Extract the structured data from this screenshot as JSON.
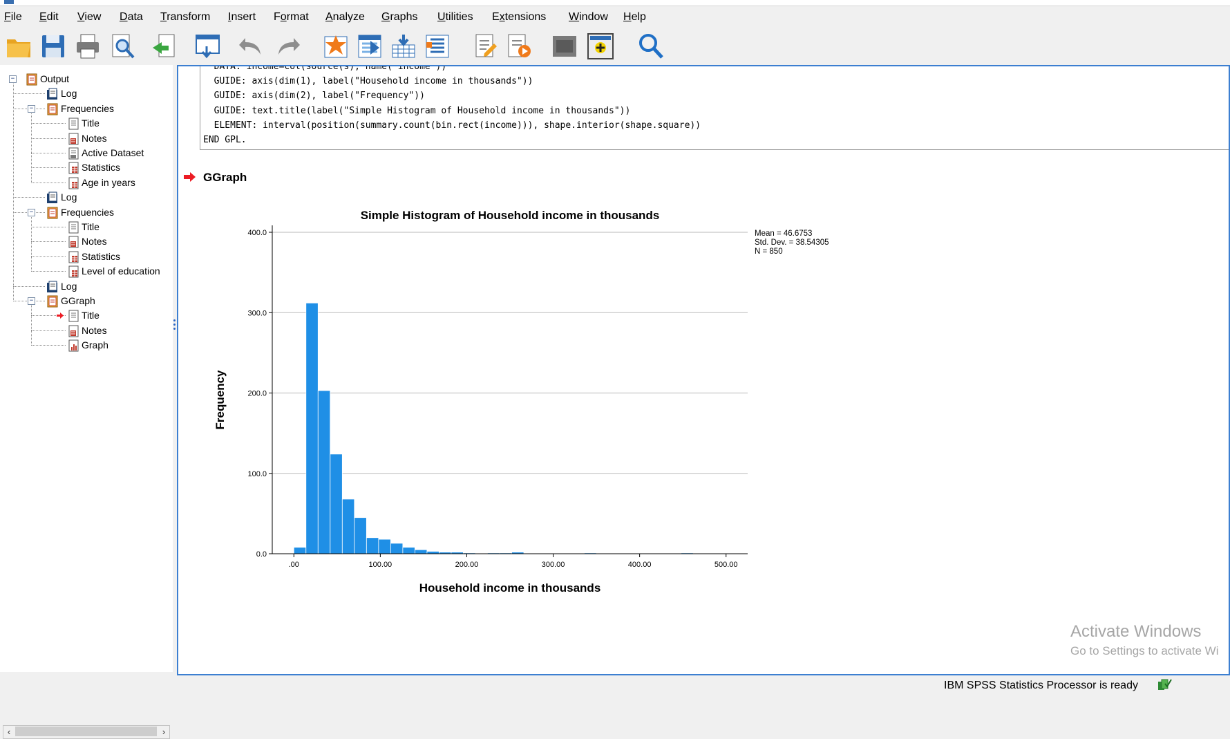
{
  "menu": [
    "File",
    "Edit",
    "View",
    "Data",
    "Transform",
    "Insert",
    "Format",
    "Analyze",
    "Graphs",
    "Utilities",
    "Extensions",
    "Window",
    "Help"
  ],
  "toolbar": [
    {
      "icon": "open-folder-icon"
    },
    {
      "icon": "save-icon"
    },
    {
      "icon": "print-icon"
    },
    {
      "icon": "print-preview-icon"
    },
    {
      "icon": "export-icon"
    },
    {
      "icon": "recall-dialog-icon"
    },
    {
      "icon": "undo-icon"
    },
    {
      "icon": "redo-icon"
    },
    {
      "icon": "goto-data-icon"
    },
    {
      "icon": "goto-case-icon"
    },
    {
      "icon": "goto-variable-icon"
    },
    {
      "icon": "variables-icon"
    },
    {
      "icon": "show-items-icon"
    },
    {
      "icon": "run-script-icon"
    },
    {
      "icon": "designate-window-icon"
    },
    {
      "icon": "new-output-icon"
    },
    {
      "icon": "search-icon"
    }
  ],
  "tree": [
    {
      "label": "Output",
      "icon": "output-book-icon",
      "level": 0,
      "expander": "minus"
    },
    {
      "label": "Log",
      "icon": "log-icon",
      "level": 1
    },
    {
      "label": "Frequencies",
      "icon": "procedure-book-icon",
      "level": 1,
      "expander": "minus"
    },
    {
      "label": "Title",
      "icon": "title-icon",
      "level": 2
    },
    {
      "label": "Notes",
      "icon": "notes-icon",
      "level": 2
    },
    {
      "label": "Active Dataset",
      "icon": "dataset-icon",
      "level": 2
    },
    {
      "label": "Statistics",
      "icon": "table-icon",
      "level": 2
    },
    {
      "label": "Age in years",
      "icon": "table-icon",
      "level": 2
    },
    {
      "label": "Log",
      "icon": "log-icon",
      "level": 1
    },
    {
      "label": "Frequencies",
      "icon": "procedure-book-icon",
      "level": 1,
      "expander": "minus"
    },
    {
      "label": "Title",
      "icon": "title-icon",
      "level": 2
    },
    {
      "label": "Notes",
      "icon": "notes-icon",
      "level": 2
    },
    {
      "label": "Statistics",
      "icon": "table-icon",
      "level": 2
    },
    {
      "label": "Level of education",
      "icon": "table-icon",
      "level": 2
    },
    {
      "label": "Log",
      "icon": "log-icon",
      "level": 1
    },
    {
      "label": "GGraph",
      "icon": "procedure-book-icon",
      "level": 1,
      "expander": "minus"
    },
    {
      "label": "Title",
      "icon": "title-icon",
      "level": 2,
      "current": true
    },
    {
      "label": "Notes",
      "icon": "notes-icon",
      "level": 2
    },
    {
      "label": "Graph",
      "icon": "chart-icon",
      "level": 2
    }
  ],
  "syntax_lines": [
    "  DATA: income=col(source(s), name(\"income\"))",
    "  GUIDE: axis(dim(1), label(\"Household income in thousands\"))",
    "  GUIDE: axis(dim(2), label(\"Frequency\"))",
    "  GUIDE: text.title(label(\"Simple Histogram of Household income in thousands\"))",
    "  ELEMENT: interval(position(summary.count(bin.rect(income))), shape.interior(shape.square))",
    "END GPL."
  ],
  "gg_header": "GGraph",
  "chart_data": {
    "type": "bar",
    "title": "Simple Histogram of Household income in thousands",
    "xlabel": "Household income in thousands",
    "ylabel": "Frequency",
    "xlim": [
      -25,
      525
    ],
    "ylim": [
      0,
      400
    ],
    "x_ticks": [
      ".00",
      "100.00",
      "200.00",
      "300.00",
      "400.00",
      "500.00"
    ],
    "x_tick_values": [
      0,
      100,
      200,
      300,
      400,
      500
    ],
    "y_ticks": [
      "0.0",
      "100.0",
      "200.0",
      "300.0",
      "400.0"
    ],
    "y_tick_values": [
      0,
      100,
      200,
      300,
      400
    ],
    "bin_width": 14,
    "bins": [
      {
        "start": 0,
        "count": 8
      },
      {
        "start": 14,
        "count": 312
      },
      {
        "start": 28,
        "count": 203
      },
      {
        "start": 42,
        "count": 124
      },
      {
        "start": 56,
        "count": 68
      },
      {
        "start": 70,
        "count": 45
      },
      {
        "start": 84,
        "count": 20
      },
      {
        "start": 98,
        "count": 18
      },
      {
        "start": 112,
        "count": 13
      },
      {
        "start": 126,
        "count": 8
      },
      {
        "start": 140,
        "count": 5
      },
      {
        "start": 154,
        "count": 3
      },
      {
        "start": 168,
        "count": 2
      },
      {
        "start": 182,
        "count": 2
      },
      {
        "start": 196,
        "count": 1
      },
      {
        "start": 224,
        "count": 1
      },
      {
        "start": 238,
        "count": 1
      },
      {
        "start": 252,
        "count": 2
      },
      {
        "start": 336,
        "count": 1
      },
      {
        "start": 448,
        "count": 1
      }
    ],
    "stats": [
      "Mean = 46.6753",
      "Std. Dev. = 38.54305",
      "N = 850"
    ],
    "bar_color": "#1f8fe6",
    "grid": true
  },
  "status": "IBM SPSS Statistics Processor is ready",
  "watermark": {
    "line1": "Activate Windows",
    "line2": "Go to Settings to activate Wi"
  }
}
